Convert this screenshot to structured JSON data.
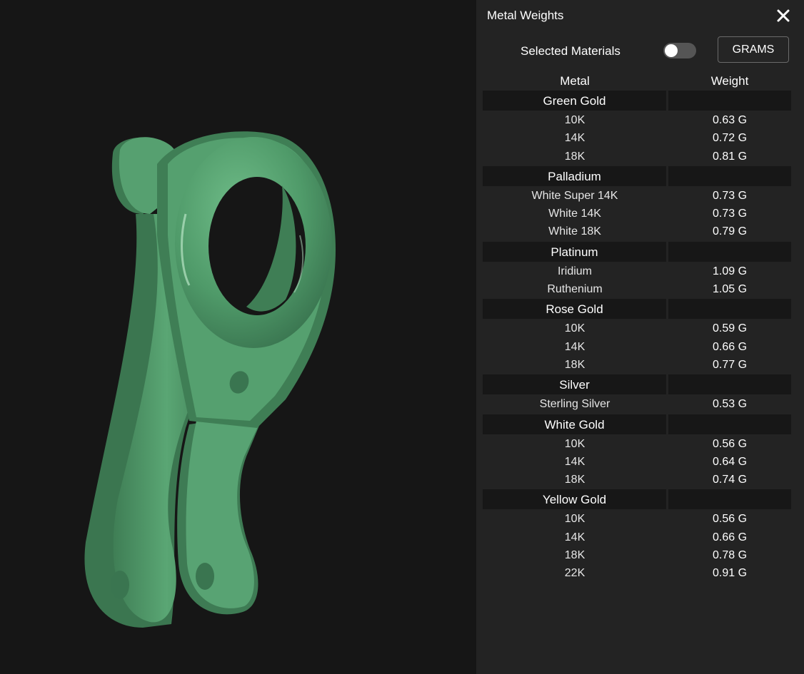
{
  "panel": {
    "title": "Metal Weights",
    "selected_materials_label": "Selected Materials",
    "selected_materials_enabled": false,
    "units_button_label": "GRAMS",
    "close_icon": "close-icon"
  },
  "table": {
    "headers": {
      "metal": "Metal",
      "weight": "Weight"
    },
    "groups": [
      {
        "name": "Green Gold",
        "items": [
          {
            "metal": "10K",
            "weight": "0.63 G"
          },
          {
            "metal": "14K",
            "weight": "0.72 G"
          },
          {
            "metal": "18K",
            "weight": "0.81 G"
          }
        ]
      },
      {
        "name": "Palladium",
        "items": [
          {
            "metal": "White Super 14K",
            "weight": "0.73 G"
          },
          {
            "metal": "White 14K",
            "weight": "0.73 G"
          },
          {
            "metal": "White 18K",
            "weight": "0.79 G"
          }
        ]
      },
      {
        "name": "Platinum",
        "items": [
          {
            "metal": "Iridium",
            "weight": "1.09 G"
          },
          {
            "metal": "Ruthenium",
            "weight": "1.05 G"
          }
        ]
      },
      {
        "name": "Rose Gold",
        "items": [
          {
            "metal": "10K",
            "weight": "0.59 G"
          },
          {
            "metal": "14K",
            "weight": "0.66 G"
          },
          {
            "metal": "18K",
            "weight": "0.77 G"
          }
        ]
      },
      {
        "name": "Silver",
        "items": [
          {
            "metal": "Sterling Silver",
            "weight": "0.53 G"
          }
        ]
      },
      {
        "name": "White Gold",
        "items": [
          {
            "metal": "10K",
            "weight": "0.56 G"
          },
          {
            "metal": "14K",
            "weight": "0.64 G"
          },
          {
            "metal": "18K",
            "weight": "0.74 G"
          }
        ]
      },
      {
        "name": "Yellow Gold",
        "items": [
          {
            "metal": "10K",
            "weight": "0.56 G"
          },
          {
            "metal": "14K",
            "weight": "0.66 G"
          },
          {
            "metal": "18K",
            "weight": "0.78 G"
          },
          {
            "metal": "22K",
            "weight": "0.91 G"
          }
        ]
      }
    ]
  },
  "viewport": {
    "model_color": "#4f9a69",
    "background_color": "#161616"
  }
}
